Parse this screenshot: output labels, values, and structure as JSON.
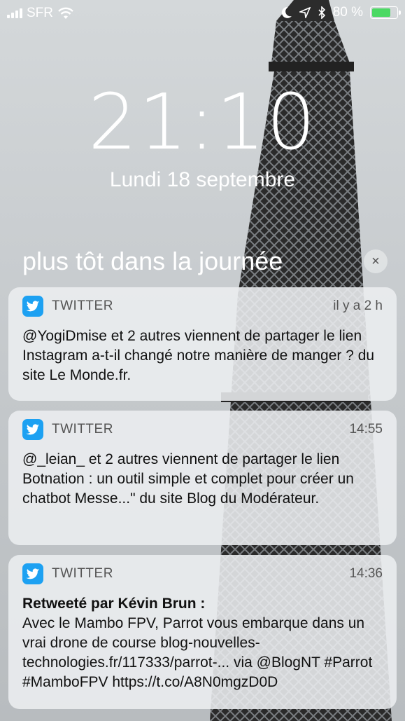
{
  "status_bar": {
    "carrier": "SFR",
    "battery_percent": "80 %",
    "battery_level": 0.8,
    "icons": [
      "signal-icon",
      "wifi-icon",
      "moon-icon",
      "location-icon",
      "bluetooth-icon",
      "battery-icon"
    ]
  },
  "lock": {
    "time": "21:10",
    "date": "Lundi 18 septembre"
  },
  "section": {
    "title": "plus tôt dans la journée",
    "clear_icon": "×"
  },
  "notifications": [
    {
      "app": "TWITTER",
      "time": "il y a 2 h",
      "title": "",
      "body": "@YogiDmise et 2 autres viennent de partager le lien Instagram a-t-il changé notre manière de manger ? du site Le Monde.fr."
    },
    {
      "app": "TWITTER",
      "time": "14:55",
      "title": "",
      "body": "@_leian_ et 2 autres viennent de partager le lien Botnation : un outil simple et complet pour créer un chatbot Messe...\" du site Blog du Modérateur."
    },
    {
      "app": "TWITTER",
      "time": "14:36",
      "title": "Retweeté par Kévin Brun :",
      "body": "Avec le Mambo FPV, Parrot vous embarque dans un vrai drone de course blog-nouvelles-technologies.fr/117333/parrot-... via @BlogNT #Parrot #MamboFPV https://t.co/A8N0mgzD0D"
    }
  ],
  "colors": {
    "twitter_blue": "#1da1f2",
    "battery_green": "#4cd964"
  }
}
